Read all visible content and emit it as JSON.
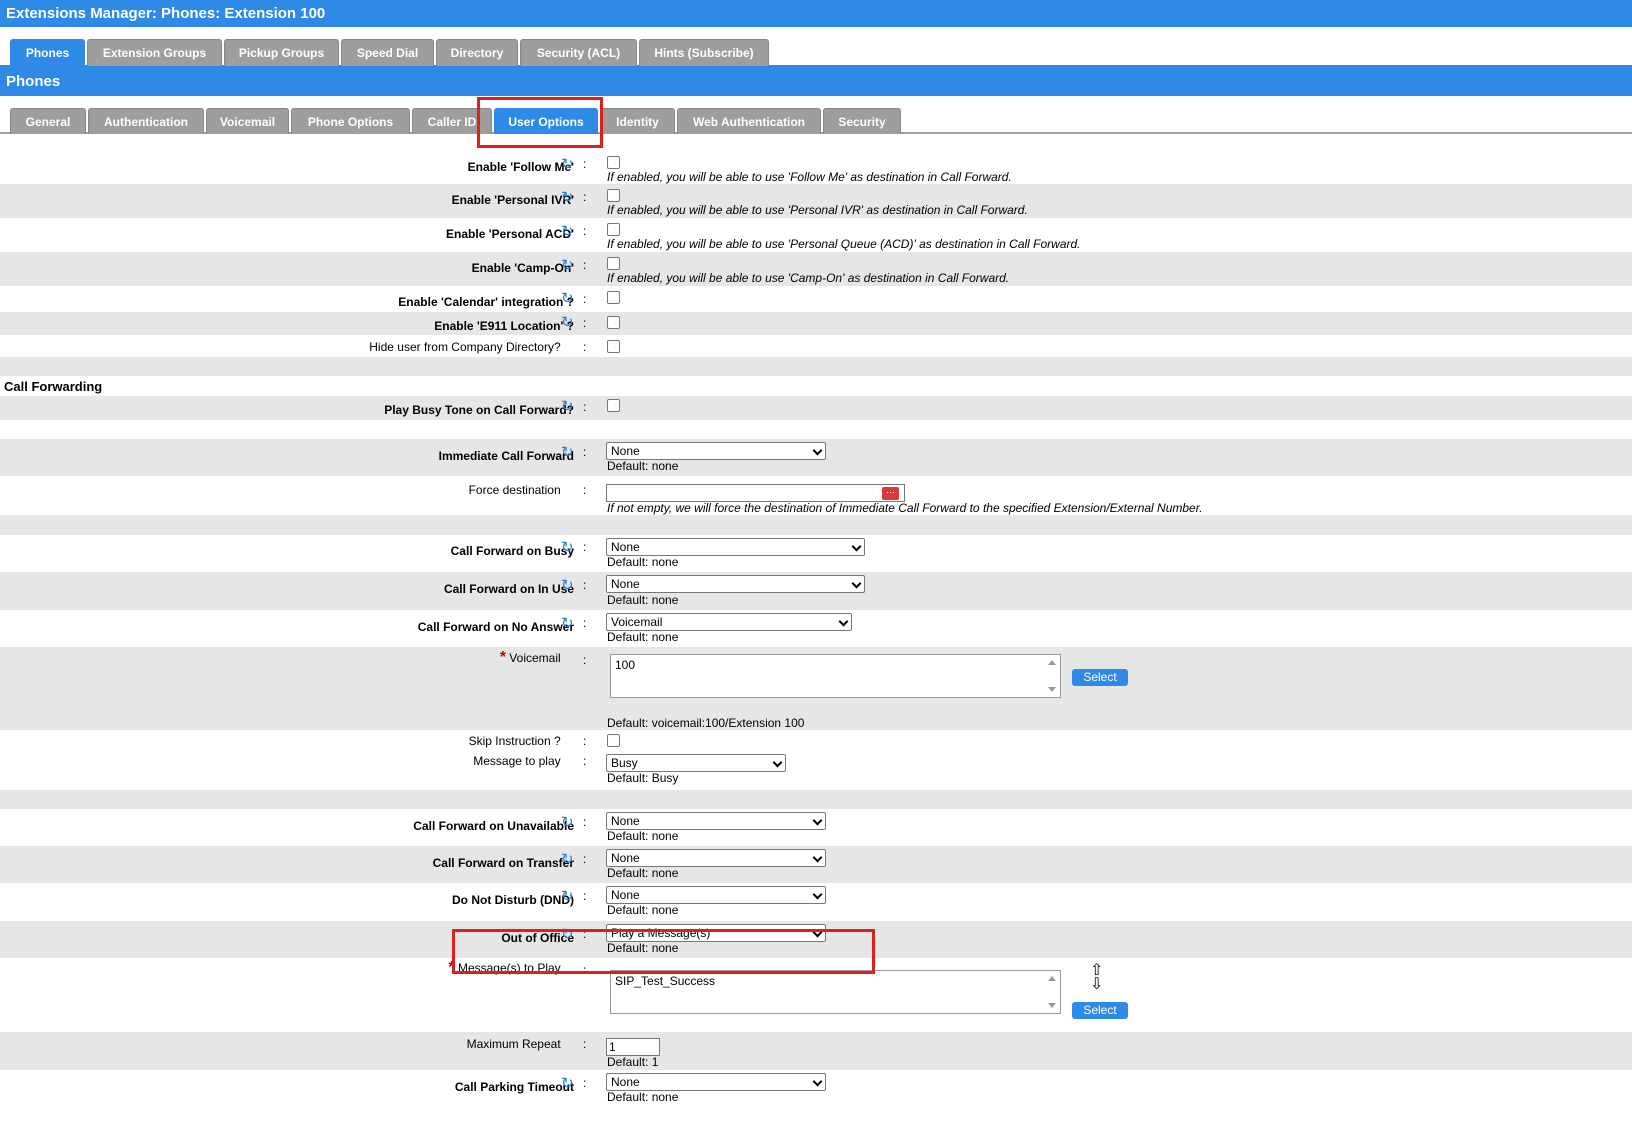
{
  "title": "Extensions Manager:  Phones:  Extension 100",
  "main_tabs": [
    "Phones",
    "Extension Groups",
    "Pickup Groups",
    "Speed Dial",
    "Directory",
    "Security (ACL)",
    "Hints (Subscribe)"
  ],
  "section_title": "Phones",
  "sub_tabs": [
    "General",
    "Authentication",
    "Voicemail",
    "Phone Options",
    "Caller ID",
    "User Options",
    "Identity",
    "Web Authentication",
    "Security"
  ],
  "colon": ":",
  "required_mark": "*",
  "options": {
    "follow_me": {
      "label": "Enable 'Follow Me'",
      "note": "If enabled, you will be able to use 'Follow Me' as destination in Call Forward."
    },
    "personal_ivr": {
      "label": "Enable 'Personal IVR'",
      "note": "If enabled, you will be able to use 'Personal IVR' as destination in Call Forward."
    },
    "personal_acd": {
      "label": "Enable 'Personal ACD'",
      "note": "If enabled, you will be able to use 'Personal Queue (ACD)' as destination in Call Forward."
    },
    "camp_on": {
      "label": "Enable 'Camp-On'",
      "note": "If enabled, you will be able to use 'Camp-On' as destination in Call Forward."
    },
    "calendar": {
      "label": "Enable 'Calendar' integration ?"
    },
    "e911": {
      "label": "Enable 'E911 Location' ?"
    },
    "hide_user": {
      "label": "Hide user from Company Directory?"
    }
  },
  "call_forwarding": {
    "heading": "Call Forwarding",
    "busy_tone": {
      "label": "Play Busy Tone on Call Forward?"
    },
    "immediate": {
      "label": "Immediate Call Forward",
      "value": "None",
      "default": "Default: none"
    },
    "force_dest": {
      "label": "Force destination",
      "value": "",
      "note": "If not empty, we will force the destination of Immediate Call Forward to the specified Extension/External Number.",
      "picker_icon": "⋯"
    },
    "on_busy": {
      "label": "Call Forward on Busy",
      "value": "None",
      "default": "Default: none"
    },
    "on_in_use": {
      "label": "Call Forward on In Use",
      "value": "None",
      "default": "Default: none"
    },
    "on_no_answer": {
      "label": "Call Forward on No Answer",
      "value": "Voicemail",
      "default": "Default: none"
    },
    "voicemail": {
      "label": "Voicemail",
      "value": "100",
      "button": "Select",
      "default": "Default: voicemail:100/Extension 100"
    },
    "skip_instruction": {
      "label": "Skip Instruction ?"
    },
    "message_to_play": {
      "label": "Message to play",
      "value": "Busy",
      "default": "Default: Busy"
    },
    "on_unavailable": {
      "label": "Call Forward on Unavailable",
      "value": "None",
      "default": "Default: none"
    },
    "on_transfer": {
      "label": "Call Forward on Transfer",
      "value": "None",
      "default": "Default: none"
    },
    "dnd": {
      "label": "Do Not Disturb (DND)",
      "value": "None",
      "default": "Default: none"
    },
    "out_of_office": {
      "label": "Out of Office",
      "value": "Play a Message(s)",
      "default": "Default: none"
    },
    "messages_to_play": {
      "label": "Message(s) to Play",
      "value": "SIP_Test_Success",
      "button": "Select",
      "reorder_icon": "⇧⇩"
    },
    "max_repeat": {
      "label": "Maximum Repeat",
      "value": "1",
      "default": "Default: 1"
    },
    "parking_timeout": {
      "label": "Call Parking Timeout",
      "value": "None",
      "default": "Default: none"
    }
  },
  "icons": {
    "reload": "↻"
  },
  "colors": {
    "accent": "#2e8ae6",
    "highlight": "#dd1f1f",
    "row_alt": "#e6e6e6",
    "tab_inactive": "#9e9e9e"
  }
}
